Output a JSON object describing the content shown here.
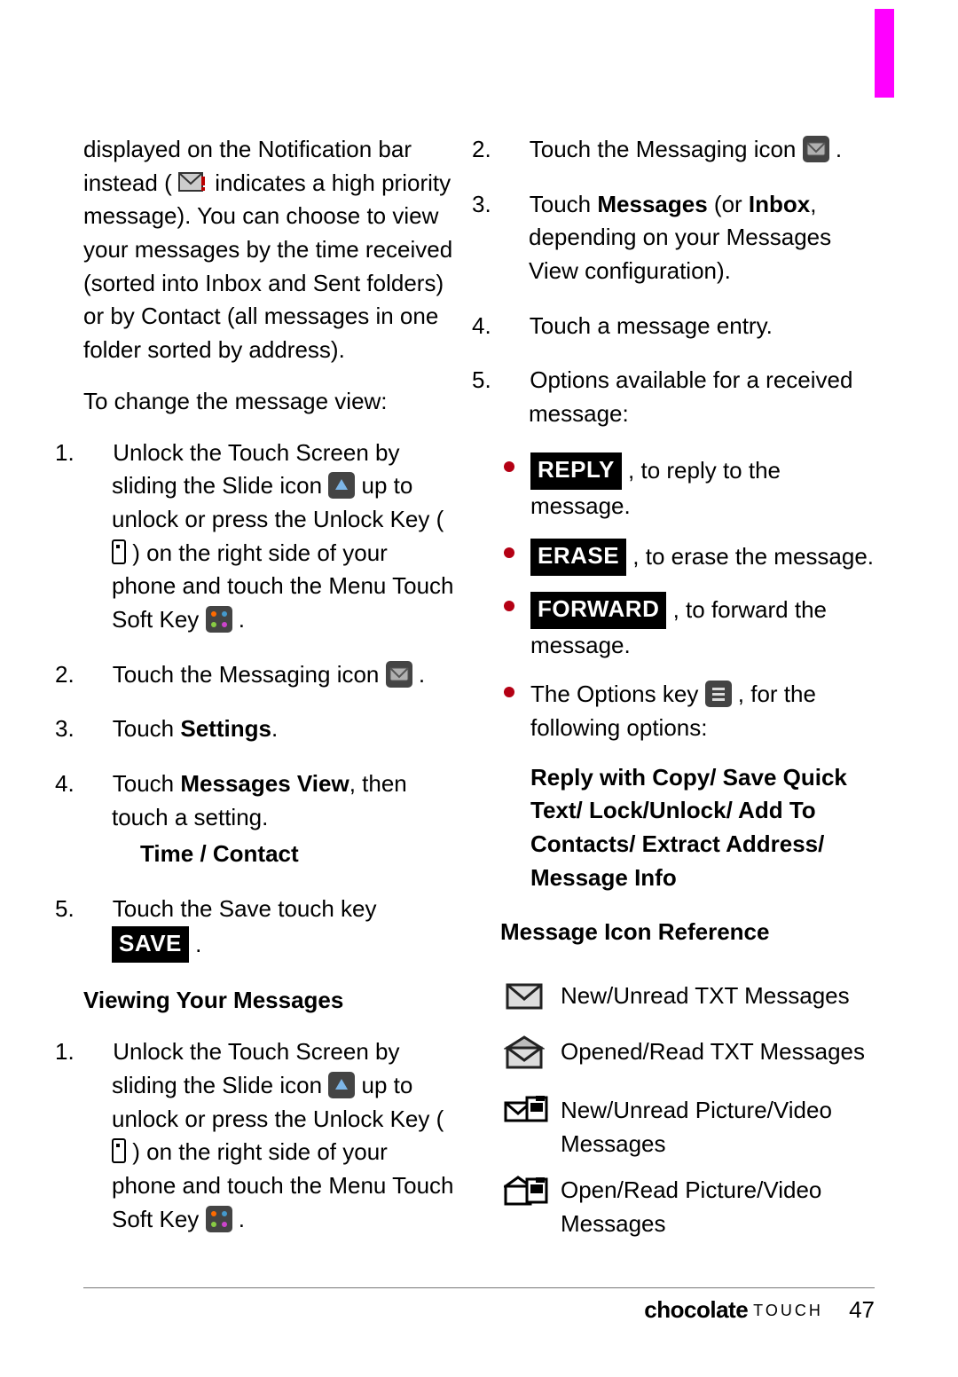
{
  "left": {
    "intro1_a": "displayed on the Notification bar instead ( ",
    "intro1_b": " indicates a high priority message). You can choose to view your messages by the time received (sorted into Inbox and Sent folders) or by Contact (all messages in one folder sorted by address).",
    "intro2": "To change the message view:",
    "steps1": {
      "s1_a": "Unlock the Touch Screen by sliding the Slide icon ",
      "s1_b": " up to unlock or press the Unlock Key ( ",
      "s1_c": " ) on the right side of your phone and touch the Menu Touch Soft Key ",
      "s1_d": " .",
      "s2_a": "Touch the Messaging icon ",
      "s2_b": " .",
      "s3_a": "Touch ",
      "s3_bold": "Settings",
      "s3_b": ".",
      "s4_a": "Touch ",
      "s4_bold": "Messages View",
      "s4_b": ", then touch a setting.",
      "s4_sub": "Time / Contact",
      "s5_a": "Touch the Save touch key ",
      "s5_btn": "SAVE",
      "s5_b": " ."
    },
    "heading_view": "Viewing Your Messages",
    "steps2": {
      "s1_a": "Unlock the Touch Screen by sliding the Slide icon ",
      "s1_b": " up to unlock or press the Unlock Key ( ",
      "s1_c": " ) on the right side of your phone and touch the Menu Touch Soft Key ",
      "s1_d": " ."
    }
  },
  "right": {
    "s2_a": "Touch the Messaging icon ",
    "s2_b": " .",
    "s3_a": "Touch ",
    "s3_bold1": "Messages",
    "s3_mid": " (or ",
    "s3_bold2": "Inbox",
    "s3_b": ", depending on your Messages View configuration).",
    "s4": "Touch a message entry.",
    "s5": "Options available for a received message:",
    "bullets": {
      "b1_btn": "REPLY",
      "b1_txt": " , to reply to the message.",
      "b2_btn": "ERASE",
      "b2_txt": " , to erase the message.",
      "b3_btn": "FORWARD",
      "b3_txt": " , to forward the message.",
      "b4_a": "The Options key ",
      "b4_b": " , for the following options:"
    },
    "opts": "Reply with Copy/ Save Quick Text/ Lock/Unlock/ Add To Contacts/ Extract Address/ Message Info",
    "heading_iconref": "Message Icon Reference",
    "iconref": {
      "r1": "New/Unread TXT Messages",
      "r2": "Opened/Read TXT Messages",
      "r3": "New/Unread Picture/Video Messages",
      "r4": "Open/Read Picture/Video Messages"
    }
  },
  "footer": {
    "brand": "chocolate",
    "sub": "TOUCH",
    "page": "47"
  }
}
